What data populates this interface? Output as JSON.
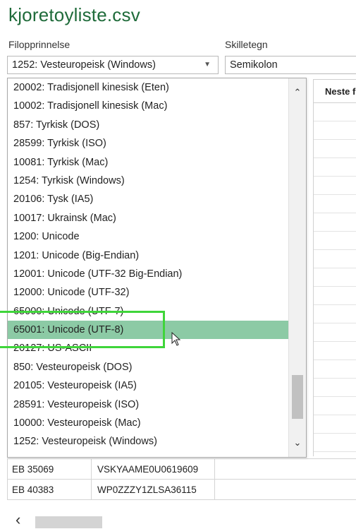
{
  "window": {
    "title": "kjoretoyliste.csv"
  },
  "controls": {
    "origin_label": "Filopprinnelse",
    "origin_value": "1252: Vesteuropeisk (Windows)",
    "separator_label": "Skilletegn",
    "separator_value": "Semikolon"
  },
  "dropdown": {
    "items": [
      "20002: Tradisjonell kinesisk (Eten)",
      "10002: Tradisjonell kinesisk (Mac)",
      "857: Tyrkisk (DOS)",
      "28599: Tyrkisk (ISO)",
      "10081: Tyrkisk (Mac)",
      "1254: Tyrkisk (Windows)",
      "20106: Tysk (IA5)",
      "10017: Ukrainsk (Mac)",
      "1200: Unicode",
      "1201: Unicode (Big-Endian)",
      "12001: Unicode (UTF-32 Big-Endian)",
      "12000: Unicode (UTF-32)",
      "65000: Unicode (UTF-7)",
      "65001: Unicode (UTF-8)",
      "20127: US-ASCII",
      "850: Vesteuropeisk (DOS)",
      "20105: Vesteuropeisk (IA5)",
      "28591: Vesteuropeisk (ISO)",
      "10000: Vesteuropeisk (Mac)",
      "1252: Vesteuropeisk (Windows)"
    ],
    "selected_index": 13
  },
  "preview": {
    "column_header": "Neste fr",
    "rows": [
      [
        "EB 35069",
        "VSKYAAME0U0619609"
      ],
      [
        "EB 40383",
        "WP0ZZZY1ZLSA36115"
      ]
    ]
  },
  "colors": {
    "title": "#1f6b3a",
    "selected_row": "#8ccaa5",
    "annotation_box": "#3fd53a"
  },
  "icons": {
    "dropdown": "chevron-down-icon",
    "scroll_up": "chevron-up-icon",
    "scroll_down": "chevron-down-icon",
    "scroll_left": "chevron-left-icon",
    "pointer": "mouse-pointer-icon"
  }
}
